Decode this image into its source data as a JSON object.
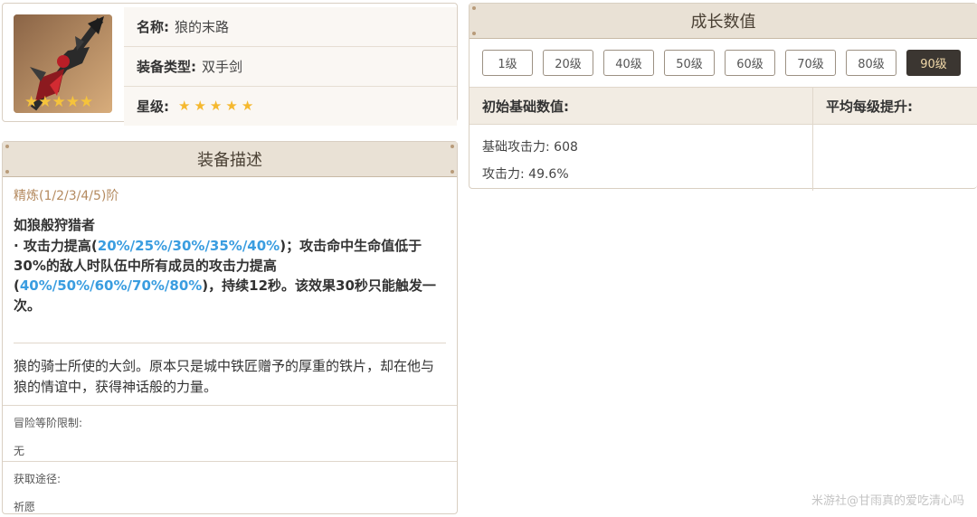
{
  "weapon": {
    "name_label": "名称:",
    "name": "狼的末路",
    "type_label": "装备类型:",
    "type": "双手剑",
    "rarity_label": "星级:",
    "rarity_stars": 5
  },
  "description": {
    "header": "装备描述",
    "refinement": "精炼(1/2/3/4/5)阶",
    "passive_name": "如狼般狩猎者",
    "passive_seg1": "· 攻击力提高(",
    "passive_hl1": "20%/25%/30%/35%/40%",
    "passive_seg2": ")；攻击命中生命值低于30%的敌人时队伍中所有成员的攻击力提高(",
    "passive_hl2": "40%/50%/60%/70%/80%",
    "passive_seg3": ")，持续12秒。该效果30秒只能触发一次。",
    "lore": "狼的骑士所使的大剑。原本只是城中铁匠赠予的厚重的铁片，却在他与狼的情谊中，获得神话般的力量。",
    "rank_limit_label": "冒险等阶限制:",
    "rank_limit_value": "无",
    "source_label": "获取途径:",
    "source_value": "祈愿"
  },
  "growth": {
    "header": "成长数值",
    "levels": [
      "1级",
      "20级",
      "40级",
      "50级",
      "60级",
      "70级",
      "80级",
      "90级"
    ],
    "active_level": "90级",
    "base_header": "初始基础数值:",
    "avg_header": "平均每级提升:",
    "base_atk": "基础攻击力: 608",
    "sub_stat": "攻击力: 49.6%"
  },
  "watermark": "米游社@甘雨真的爱吃清心吗",
  "colors": {
    "highlight": "#3a9de0",
    "star": "#f5b82e",
    "header_bg": "#e9e1d5",
    "active_level_bg": "#3b3631"
  }
}
